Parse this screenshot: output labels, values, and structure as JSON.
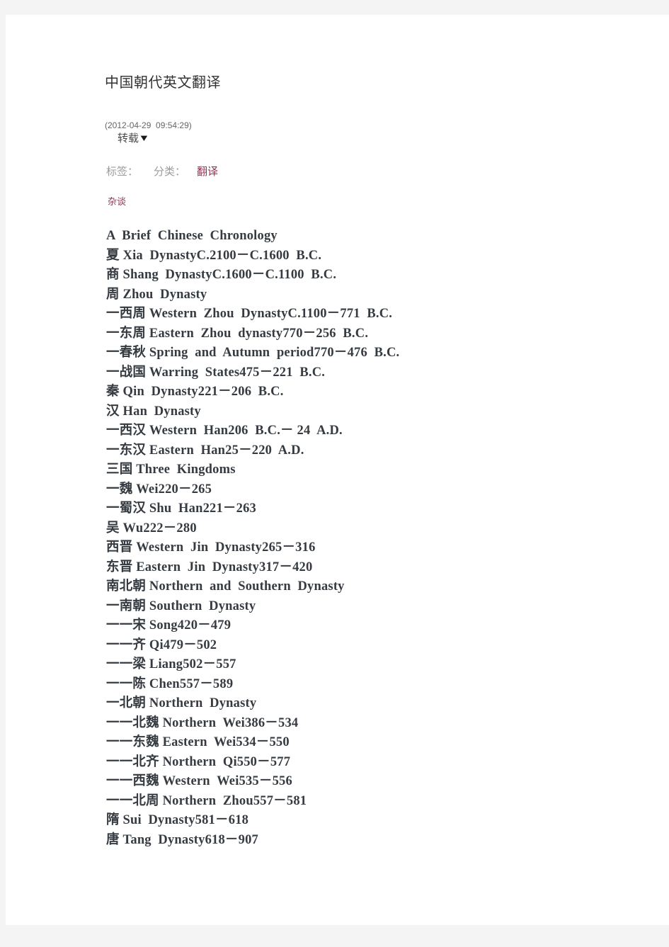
{
  "page": {
    "background_color": "#f4f4f4",
    "sheet_color": "#ffffff"
  },
  "article": {
    "title": "中国朝代英文翻译",
    "post_time": "(2012-04-29  09:54:29)",
    "repost_label": "转载",
    "repost_caret": "▼",
    "tag_label": "标签：",
    "category_label": "分类：",
    "category_value": "翻译",
    "sub_tag": "杂谈",
    "accent_color": "#8e3552",
    "meta_color": "#9b9b9b",
    "body_color": "#353b41"
  },
  "chronology": {
    "heading": "A  Brief  Chinese  Chronology",
    "lines": [
      "A  Brief  Chinese  Chronology",
      "夏 Xia  DynastyC.2100－C.1600  B.C.",
      "商 Shang  DynastyC.1600－C.1100  B.C.",
      "周 Zhou  Dynasty",
      "一西周 Western  Zhou  DynastyC.1100－771  B.C.",
      "一东周 Eastern  Zhou  dynasty770－256  B.C.",
      "一春秋 Spring  and  Autumn  period770－476  B.C.",
      "一战国 Warring  States475－221  B.C.",
      "秦 Qin  Dynasty221－206  B.C.",
      "汉 Han  Dynasty",
      "一西汉 Western  Han206  B.C.－ 24  A.D.",
      "一东汉 Eastern  Han25－220  A.D.",
      "三国 Three  Kingdoms",
      "一魏 Wei220－265",
      "一蜀汉 Shu  Han221－263",
      "吴 Wu222－280",
      "西晋 Western  Jin  Dynasty265－316",
      "东晋 Eastern  Jin  Dynasty317－420",
      "南北朝 Northern  and  Southern  Dynasty",
      "一南朝 Southern  Dynasty",
      "一一宋 Song420－479",
      "一一齐 Qi479－502",
      "一一梁 Liang502－557",
      "一一陈 Chen557－589",
      "一北朝 Northern  Dynasty",
      "一一北魏 Northern  Wei386－534",
      "一一东魏 Eastern  Wei534－550",
      "一一北齐 Northern  Qi550－577",
      "一一西魏 Western  Wei535－556",
      "一一北周 Northern  Zhou557－581",
      "隋 Sui  Dynasty581－618",
      "唐 Tang  Dynasty618－907"
    ]
  }
}
